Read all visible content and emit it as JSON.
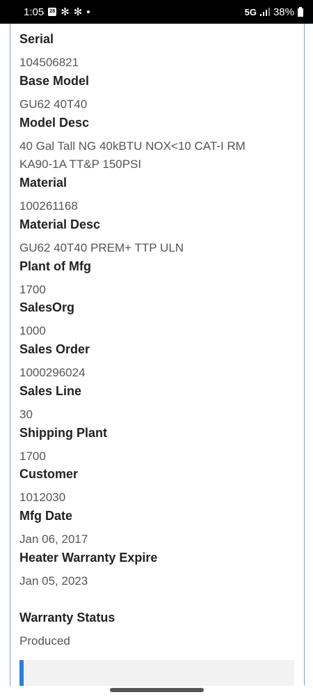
{
  "status_bar": {
    "time": "1:05",
    "calendar_day": "28",
    "network": "5G",
    "battery": "38%"
  },
  "fields": [
    {
      "label": "Serial",
      "value": "104506821"
    },
    {
      "label": "Base Model",
      "value": "GU62 40T40"
    },
    {
      "label": "Model Desc",
      "value": "40 Gal Tall NG 40kBTU NOX<10 CAT-I RM\nKA90-1A TT&P 150PSI"
    },
    {
      "label": "Material",
      "value": "100261168"
    },
    {
      "label": "Material Desc",
      "value": "GU62 40T40 PREM+ TTP ULN"
    },
    {
      "label": "Plant of Mfg",
      "value": "1700"
    },
    {
      "label": "SalesOrg",
      "value": "1000"
    },
    {
      "label": "Sales Order",
      "value": "1000296024"
    },
    {
      "label": "Sales Line",
      "value": "30"
    },
    {
      "label": "Shipping Plant",
      "value": "1700"
    },
    {
      "label": "Customer",
      "value": "1012030"
    },
    {
      "label": "Mfg Date",
      "value": "Jan 06, 2017"
    },
    {
      "label": "Heater Warranty Expire",
      "value": "Jan 05, 2023"
    },
    {
      "label": "Warranty Status",
      "value": "Produced"
    }
  ]
}
